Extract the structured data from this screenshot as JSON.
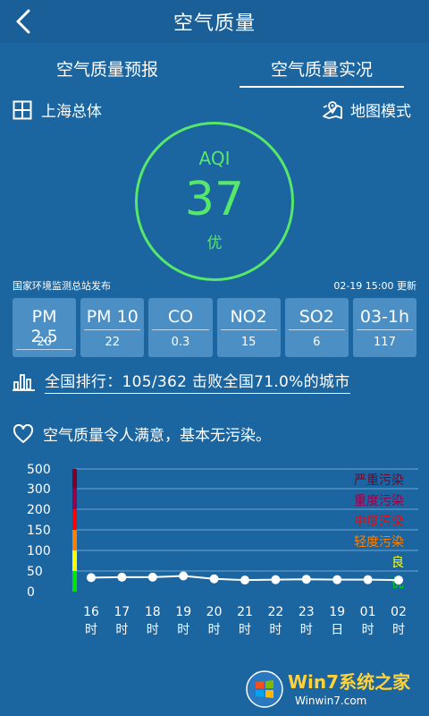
{
  "header": {
    "title": "空气质量",
    "back_icon": "chevron-left-icon"
  },
  "tabs": [
    {
      "label": "空气质量预报",
      "active": false
    },
    {
      "label": "空气质量实况",
      "active": true
    }
  ],
  "region": {
    "name": "上海总体",
    "icon": "expand-square-icon"
  },
  "map_mode": {
    "label": "地图模式",
    "icon": "map-pin-icon"
  },
  "aqi": {
    "label": "AQI",
    "value": "37",
    "level": "优",
    "color": "#57e86b"
  },
  "source": {
    "publisher": "国家环境监测总站发布",
    "updated": "02-19 15:00 更新"
  },
  "pollutants": [
    {
      "name": "PM 2.5",
      "value": "20"
    },
    {
      "name": "PM 10",
      "value": "22"
    },
    {
      "name": "CO",
      "value": "0.3"
    },
    {
      "name": "NO2",
      "value": "15"
    },
    {
      "name": "SO2",
      "value": "6"
    },
    {
      "name": "03-1h",
      "value": "117"
    }
  ],
  "ranking": {
    "text": "全国排行：105/362 击败全国71.0%的城市",
    "icon": "bar-chart-icon"
  },
  "satisfaction": {
    "text": "空气质量令人满意，基本无污染。",
    "icon": "heart-icon"
  },
  "chart_data": {
    "type": "line",
    "y_ticks": [
      "500",
      "300",
      "200",
      "150",
      "100",
      "50",
      "0"
    ],
    "levels": [
      {
        "label": "严重污染",
        "color": "#7e0023"
      },
      {
        "label": "重度污染",
        "color": "#99004c"
      },
      {
        "label": "中度污染",
        "color": "#ff0000"
      },
      {
        "label": "轻度污染",
        "color": "#ff7e00"
      },
      {
        "label": "良",
        "color": "#ffff00"
      },
      {
        "label": "优",
        "color": "#00e400"
      }
    ],
    "categories": [
      [
        "16",
        "时"
      ],
      [
        "17",
        "时"
      ],
      [
        "18",
        "时"
      ],
      [
        "19",
        "时"
      ],
      [
        "20",
        "时"
      ],
      [
        "21",
        "时"
      ],
      [
        "22",
        "时"
      ],
      [
        "23",
        "时"
      ],
      [
        "19",
        "日"
      ],
      [
        "01",
        "时"
      ],
      [
        "02",
        "时"
      ]
    ],
    "values": [
      34,
      35,
      35,
      38,
      31,
      28,
      29,
      30,
      29,
      29,
      28
    ],
    "ylim": [
      0,
      500
    ]
  },
  "watermark": {
    "title": "Win7系统之家",
    "url": "Winwin7.com"
  }
}
